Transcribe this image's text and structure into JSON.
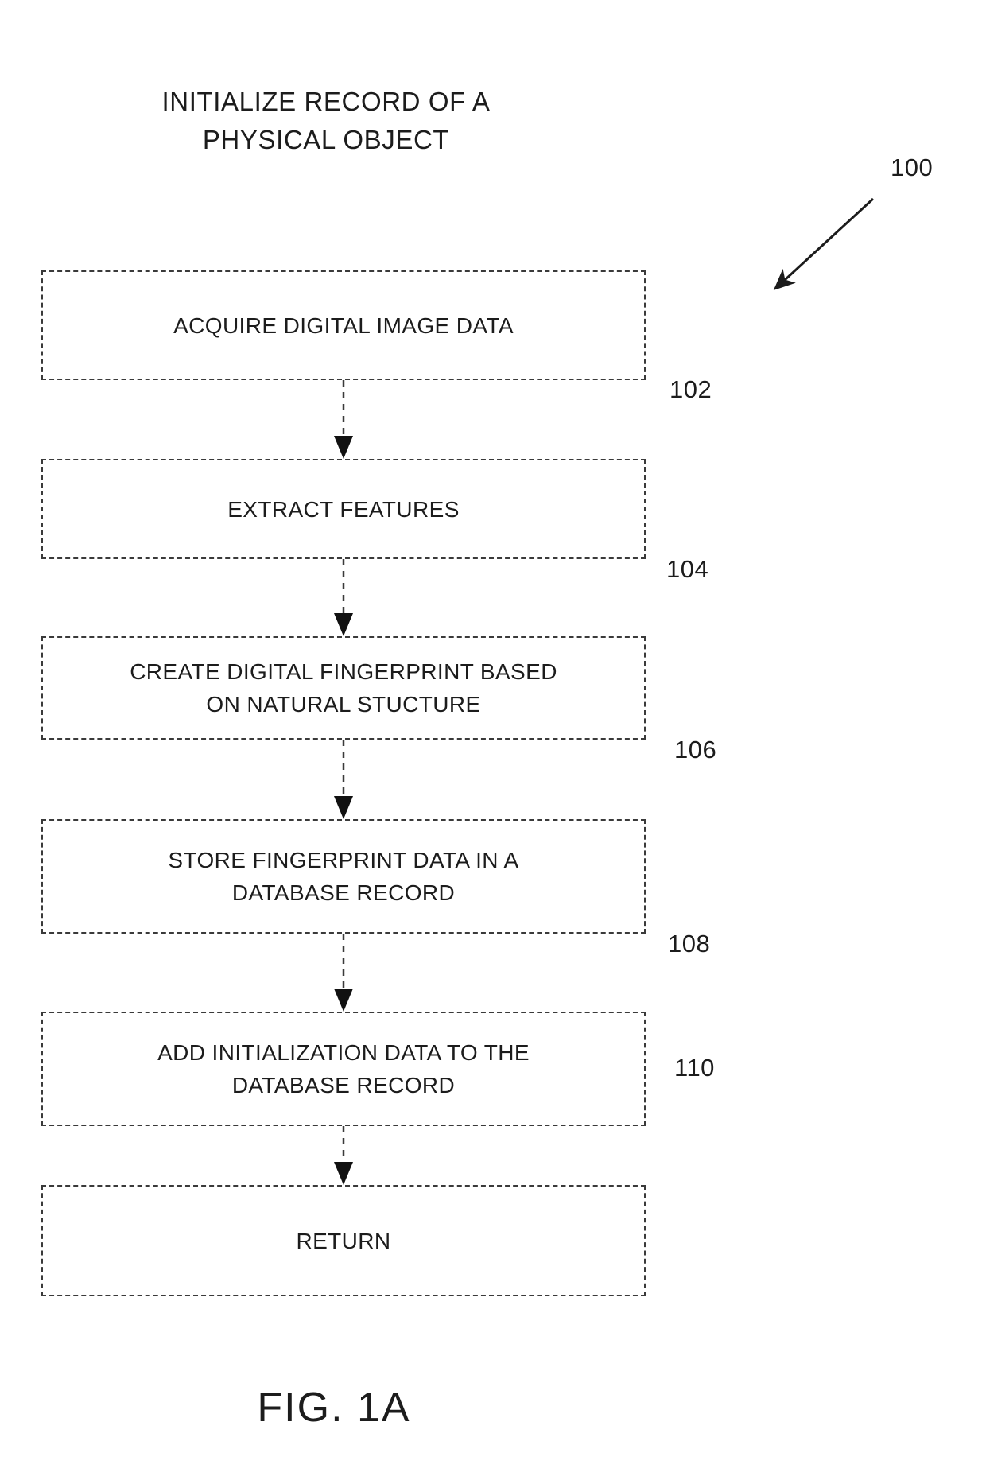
{
  "figure": {
    "title": "INITIALIZE RECORD OF A\nPHYSICAL OBJECT",
    "caption": "FIG. 1A",
    "overall_ref": "100"
  },
  "flow": {
    "steps": [
      {
        "id": "acquire",
        "text": "ACQUIRE DIGITAL IMAGE DATA",
        "ref": "102"
      },
      {
        "id": "extract",
        "text": "EXTRACT FEATURES",
        "ref": "104"
      },
      {
        "id": "create",
        "text": "CREATE DIGITAL FINGERPRINT BASED\nON NATURAL STUCTURE",
        "ref": "106"
      },
      {
        "id": "store",
        "text": "STORE FINGERPRINT DATA IN A\nDATABASE RECORD",
        "ref": "108"
      },
      {
        "id": "add",
        "text": "ADD INITIALIZATION DATA TO THE\nDATABASE RECORD",
        "ref": "110"
      },
      {
        "id": "return",
        "text": "RETURN",
        "ref": ""
      }
    ]
  },
  "style": {
    "ink": "#1c1c1c",
    "border": "#3a3a3a",
    "background": "#ffffff"
  }
}
